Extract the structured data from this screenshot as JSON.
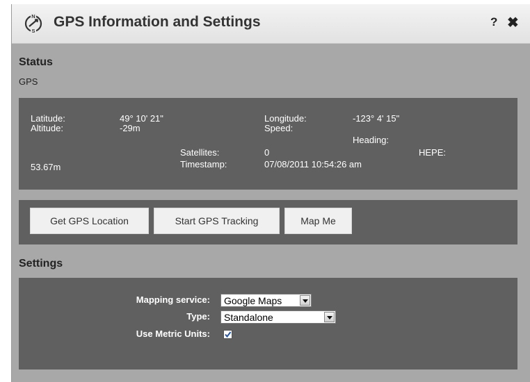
{
  "window": {
    "title": "GPS Information and Settings",
    "help_label": "?",
    "close_label": "✖"
  },
  "status": {
    "heading": "Status",
    "subtitle": "GPS",
    "latitude_label": "Latitude:",
    "latitude_value": "49° 10' 21\"",
    "longitude_label": "Longitude:",
    "longitude_value": "-123° 4' 15\"",
    "altitude_label": "Altitude:",
    "altitude_value": "-29m",
    "speed_label": "Speed:",
    "heading_label": "Heading:",
    "satellites_label": "Satellites:",
    "satellites_value": "0",
    "hepe_label": "HEPE:",
    "hepe_value": "53.67m",
    "timestamp_label": "Timestamp:",
    "timestamp_value": "07/08/2011 10:54:26 am"
  },
  "actions": {
    "get_location": "Get GPS Location",
    "start_tracking": "Start GPS Tracking",
    "map_me": "Map Me"
  },
  "settings": {
    "heading": "Settings",
    "mapping_service_label": "Mapping service:",
    "mapping_service_value": "Google Maps",
    "type_label": "Type:",
    "type_value": "Standalone",
    "metric_label": "Use Metric Units:",
    "metric_checked": true
  },
  "icons": {
    "title": "compass-icon",
    "check": "checkmark-icon"
  }
}
